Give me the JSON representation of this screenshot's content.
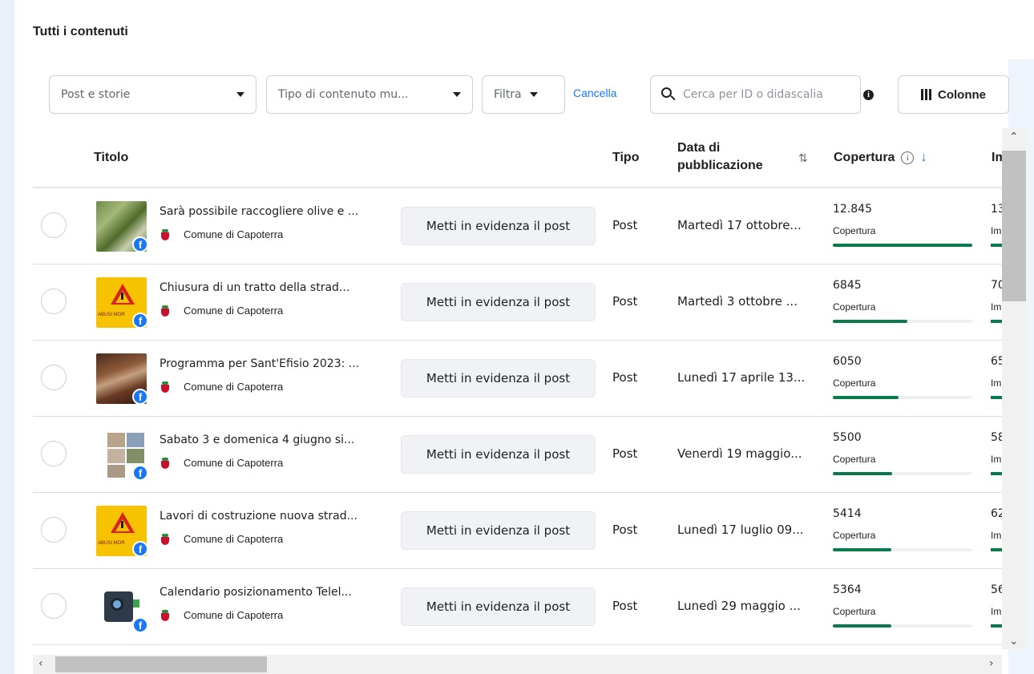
{
  "section_title": "Tutti i contenuti",
  "toolbar": {
    "post_type_select": "Post e storie",
    "content_type_select": "Tipo di contenuto mu...",
    "filter_label": "Filtra",
    "cancel_label": "Cancella",
    "search_placeholder": "Cerca per ID o didascalia",
    "columns_label": "Colonne"
  },
  "table": {
    "headers": {
      "title": "Titolo",
      "type": "Tipo",
      "date": "Data di pubblicazione",
      "reach": "Copertura",
      "impressions": "Im"
    },
    "boost_label": "Metti in evidenza il post",
    "rows": [
      {
        "title": "Sarà possibile raccogliere olive e ...",
        "page": "Comune di Capoterra",
        "type": "Post",
        "date": "Martedì 17 ottobre...",
        "reach": "12.845",
        "reach_label": "Copertura",
        "reach_fraction": 1.0,
        "impressions": "13",
        "impressions_label": "Im"
      },
      {
        "title": "Chiusura di un tratto della strad...",
        "page": "Comune di Capoterra",
        "type": "Post",
        "date": "Martedì 3 ottobre ...",
        "reach": "6845",
        "reach_label": "Copertura",
        "reach_fraction": 0.533,
        "impressions": "70",
        "impressions_label": "Im"
      },
      {
        "title": "Programma per Sant'Efisio 2023: ...",
        "page": "Comune di Capoterra",
        "type": "Post",
        "date": "Lunedì 17 aprile 13...",
        "reach": "6050",
        "reach_label": "Copertura",
        "reach_fraction": 0.471,
        "impressions": "65",
        "impressions_label": "Im"
      },
      {
        "title": "Sabato 3 e domenica 4 giugno si...",
        "page": "Comune di Capoterra",
        "type": "Post",
        "date": "Venerdì 19 maggio...",
        "reach": "5500",
        "reach_label": "Copertura",
        "reach_fraction": 0.428,
        "impressions": "58",
        "impressions_label": "Im"
      },
      {
        "title": "Lavori di costruzione nuova strad...",
        "page": "Comune di Capoterra",
        "type": "Post",
        "date": "Lunedì 17 luglio 09...",
        "reach": "5414",
        "reach_label": "Copertura",
        "reach_fraction": 0.421,
        "impressions": "62",
        "impressions_label": "Im"
      },
      {
        "title": "Calendario posizionamento Telel...",
        "page": "Comune di Capoterra",
        "type": "Post",
        "date": "Lunedì 29 maggio ...",
        "reach": "5364",
        "reach_label": "Copertura",
        "reach_fraction": 0.418,
        "impressions": "56",
        "impressions_label": "Im"
      }
    ]
  },
  "colors": {
    "accent": "#1877f2",
    "bar": "#0b7a4b"
  },
  "icons": [
    "search-icon",
    "info-icon",
    "columns-icon",
    "sort-icon",
    "arrow-down-icon",
    "facebook-icon",
    "crest-icon"
  ]
}
